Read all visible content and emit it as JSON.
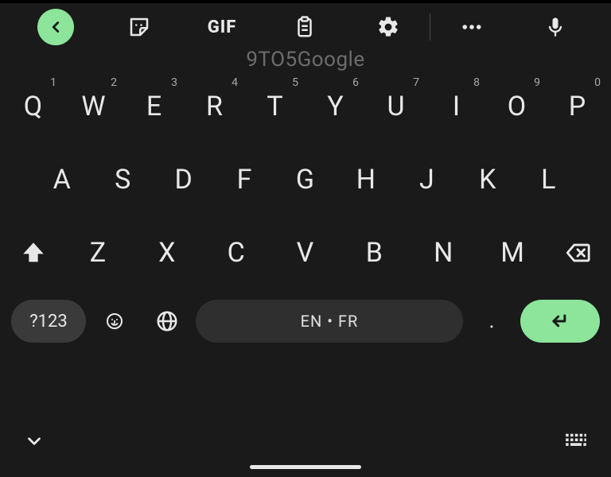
{
  "watermark": "9TO5Google",
  "toolbar": {
    "gif_label": "GIF"
  },
  "rows": {
    "r1": [
      {
        "k": "Q",
        "n": "1"
      },
      {
        "k": "W",
        "n": "2"
      },
      {
        "k": "E",
        "n": "3"
      },
      {
        "k": "R",
        "n": "4"
      },
      {
        "k": "T",
        "n": "5"
      },
      {
        "k": "Y",
        "n": "6"
      },
      {
        "k": "U",
        "n": "7"
      },
      {
        "k": "I",
        "n": "8"
      },
      {
        "k": "O",
        "n": "9"
      },
      {
        "k": "P",
        "n": "0"
      }
    ],
    "r2": [
      "A",
      "S",
      "D",
      "F",
      "G",
      "H",
      "J",
      "K",
      "L"
    ],
    "r3": [
      "Z",
      "X",
      "C",
      "V",
      "B",
      "N",
      "M"
    ]
  },
  "bottom": {
    "symbols_label": "?123",
    "comma": ",",
    "space_label": "EN • FR",
    "period": "."
  }
}
